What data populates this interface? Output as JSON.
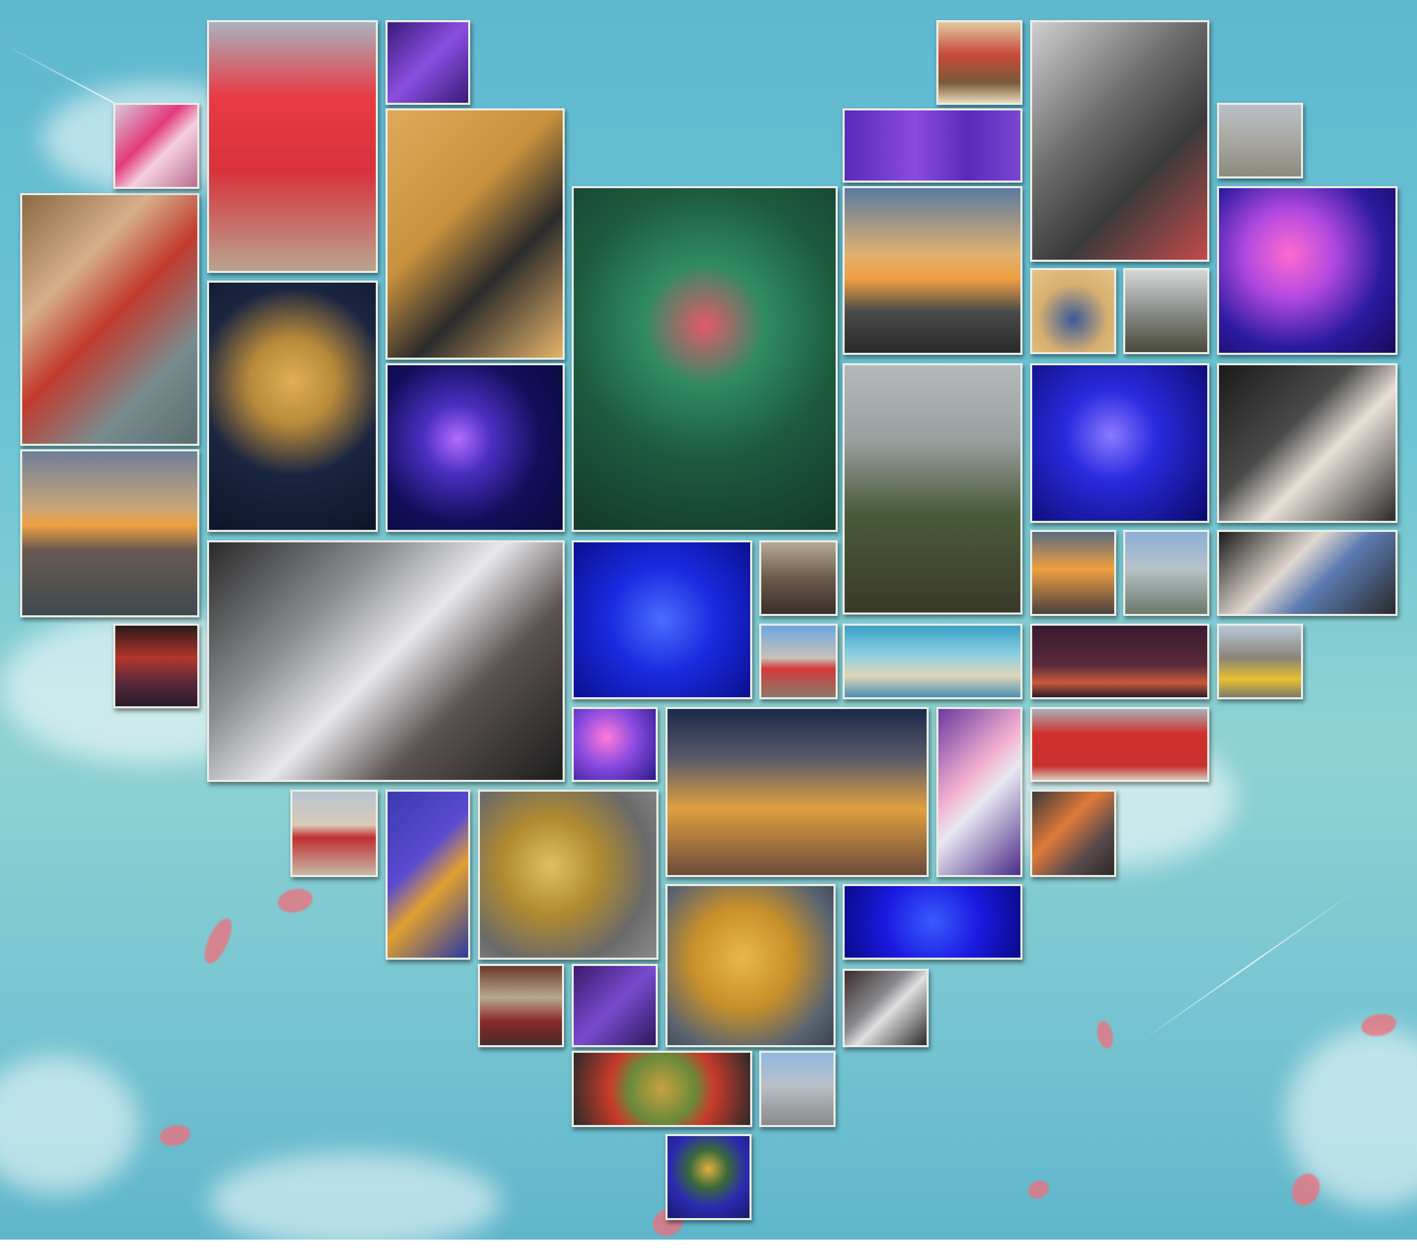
{
  "photos": [
    {
      "id": "p01",
      "name": "photo-man-in-mouth-painting",
      "bg": "linear-gradient(135deg,#8a6a44,#d6b08a 30%,#c23a2e 50%,#7a8b8e 75%,#5a6d6f)"
    },
    {
      "id": "p02",
      "name": "photo-sunset-city-left",
      "bg": "linear-gradient(180deg,#6f7f98,#c9a678 35%,#f0a040 45%,#6a5a52 60%,#3f4a4f)"
    },
    {
      "id": "p03",
      "name": "photo-small-pink-tower",
      "bg": "linear-gradient(135deg,#d7c8d8,#e23a7b 40%,#f4d0df 60%,#b86b8e)"
    },
    {
      "id": "p04",
      "name": "photo-red-arch-gate",
      "bg": "linear-gradient(180deg,#a8b3bd,#e83a44 30%,#d8323c 60%,#b9a48f)"
    },
    {
      "id": "p05",
      "name": "photo-purple-lights-small",
      "bg": "linear-gradient(135deg,#3a1a7a,#8a4fe0 50%,#3a1a7a)"
    },
    {
      "id": "p06",
      "name": "photo-devil-horns-afro",
      "bg": "linear-gradient(135deg,#e0a95a,#c8913e 40%,#2b2b2b 65%,#e5b36a)"
    },
    {
      "id": "p07",
      "name": "photo-angel-wings-painting",
      "bg": "radial-gradient(circle at 50% 40%,#e0b055 0,#b98a3a 25%,#1a2540 55%,#0d1528 100%)"
    },
    {
      "id": "p08",
      "name": "photo-jellyfish-violet",
      "bg": "radial-gradient(circle at 40% 45%,#b36dff 0,#4a2ec0 25%,#120e5a 60%,#0a0a3a)"
    },
    {
      "id": "p09",
      "name": "photo-red-corridor",
      "bg": "linear-gradient(180deg,#2a1a1a,#b3362c 40%,#5a2a3a 70%,#2a1a2a)"
    },
    {
      "id": "p10",
      "name": "photo-couple-3d-glasses",
      "bg": "linear-gradient(135deg,#2a2a2a,#8a8c90 30%,#e8e8ec 50%,#5a5250 70%,#1e1e1e)"
    },
    {
      "id": "p11",
      "name": "photo-throne-green-room",
      "bg": "radial-gradient(circle at 50% 40%,#e25a6a 0,#2f8b62 25%,#1d5a40 55%,#143828)"
    },
    {
      "id": "p12",
      "name": "photo-jellyfish-blue-tank",
      "bg": "radial-gradient(circle at 50% 50%,#4a6dff 0,#1a2ae0 45%,#0a1090)"
    },
    {
      "id": "p13",
      "name": "photo-woman-in-alley",
      "bg": "linear-gradient(180deg,#b9a995,#6a5a4a 50%,#3a2f2a)"
    },
    {
      "id": "p14",
      "name": "photo-red-gate-distance",
      "bg": "linear-gradient(180deg,#6da5e0,#c8c2b8 45%,#d23a3a 60%,#8a7a6a)"
    },
    {
      "id": "p15",
      "name": "photo-balloon-basket-mural",
      "bg": "linear-gradient(180deg,#e0c9a0,#c94a3a 40%,#7a5a3a 75%,#e8d9bb)"
    },
    {
      "id": "p16",
      "name": "photo-purple-lights-wide",
      "bg": "linear-gradient(90deg,#5a2ab8,#8a4be0 40%,#5a2ab8 70%,#7a46d4)"
    },
    {
      "id": "p17",
      "name": "photo-sunset-clouds-city",
      "bg": "linear-gradient(180deg,#5a7aa0,#e0b070 40%,#f0a040 55%,#4a4a4a 75%,#2a2a2a)"
    },
    {
      "id": "p18",
      "name": "photo-rock-diorama",
      "bg": "linear-gradient(180deg,#b4b8b8,#9aa0a0 30%,#4a5a3a 60%,#3a3a2a)"
    },
    {
      "id": "p19",
      "name": "photo-steam-train-mural",
      "bg": "linear-gradient(135deg,#cfcfcf,#6a6a6a 40%,#3a3a3a 65%,#c34a4a)"
    },
    {
      "id": "p20",
      "name": "photo-butterfly-art",
      "bg": "radial-gradient(circle at 50% 60%,#3a5a9a 0,#d8b070 55%,#e3c288)"
    },
    {
      "id": "p21",
      "name": "photo-rocky-cliff",
      "bg": "linear-gradient(180deg,#d6d8d8,#8a8e8a 50%,#4a4a3a)"
    },
    {
      "id": "p22",
      "name": "photo-jellyfish-blue-small",
      "bg": "radial-gradient(circle at 45% 45%,#8a7aff 0,#2a2ae0 35%,#0a0a6a)"
    },
    {
      "id": "p23",
      "name": "photo-sunset-skyline-small",
      "bg": "linear-gradient(180deg,#5a6a80,#f0a040 45%,#4a4040)"
    },
    {
      "id": "p24",
      "name": "photo-city-river",
      "bg": "linear-gradient(180deg,#8ab0d8,#b8c2c8 45%,#6a7a6a)"
    },
    {
      "id": "p25",
      "name": "photo-interior-mural-room",
      "bg": "linear-gradient(180deg,#3aa0c8,#8ad0e0 40%,#e0d6b8 70%,#4a90b0)"
    },
    {
      "id": "p26",
      "name": "photo-night-city",
      "bg": "linear-gradient(180deg,#3a1a30,#5a2a3a 55%,#c85a3a 80%,#2a1a2a)"
    },
    {
      "id": "p27",
      "name": "photo-rubber-ducks",
      "bg": "linear-gradient(180deg,#b8c8d8,#8a8478 45%,#e8c030 75%,#7a7a6a)"
    },
    {
      "id": "p28",
      "name": "photo-grey-plaza",
      "bg": "linear-gradient(180deg,#b8c0c8,#a8a8a0 50%,#8a8a80)"
    },
    {
      "id": "p29",
      "name": "photo-pink-jellyfish",
      "bg": "radial-gradient(circle at 40% 40%,#ff6ad0 0,#b34ae0 30%,#2a1aa0 65%,#1a0a5a)"
    },
    {
      "id": "p30",
      "name": "photo-hands-card-1",
      "bg": "linear-gradient(135deg,#1a1a1a,#4a4a4a 40%,#e8e0d8 60%,#2a2a2a)"
    },
    {
      "id": "p31",
      "name": "photo-hands-card-2",
      "bg": "linear-gradient(135deg,#1a1a1a,#e0d8d0 40%,#5a7ab0 60%,#2a2a2a)"
    },
    {
      "id": "p32",
      "name": "photo-jellyfish-pink-small",
      "bg": "radial-gradient(circle at 40% 40%,#ff7ad8 0,#8a4ae0 45%,#2a1a8a)"
    },
    {
      "id": "p33",
      "name": "photo-dinner-fish-dish",
      "bg": "linear-gradient(180deg,#1a2a4a,#5a5a6a 30%,#e0a040 60%,#6a4a3a)"
    },
    {
      "id": "p34",
      "name": "photo-candy-pillar",
      "bg": "linear-gradient(135deg,#6a3aa0,#f4b0d0 40%,#e8e8f0 55%,#4a2a8a)"
    },
    {
      "id": "p35",
      "name": "photo-red-round-door",
      "bg": "linear-gradient(180deg,#a8b0b8,#d0302c 35%,#c83030 80%,#d8c8b8)"
    },
    {
      "id": "p36",
      "name": "photo-sunset-building",
      "bg": "linear-gradient(135deg,#3a3a3a,#e07a3a 40%,#5a4a4a 70%,#2a2a2a)"
    },
    {
      "id": "p37",
      "name": "photo-red-target-wall",
      "bg": "linear-gradient(180deg,#b8c4d0,#d8cab8 40%,#c03030 55%,#c8b8a8)"
    },
    {
      "id": "p38",
      "name": "photo-little-prince-man",
      "bg": "linear-gradient(135deg,#3a3ab0,#5a4ad0 40%,#e0a030 60%,#2a3aa0)"
    },
    {
      "id": "p39",
      "name": "photo-golden-dragon",
      "bg": "radial-gradient(circle at 40% 45%,#e0c060 0,#b08a30 35%,#6a6a6a 70%,#8a8a8a)"
    },
    {
      "id": "p40",
      "name": "photo-handprint-star",
      "bg": "radial-gradient(circle at 45% 45%,#e8b84a 0,#c8902a 40%,#5a6470 75%,#3a4450)"
    },
    {
      "id": "p41",
      "name": "photo-jellyfish-blue-wide",
      "bg": "radial-gradient(circle at 50% 50%,#3a5aff 0,#1a1ae0 50%,#0a0a8a)"
    },
    {
      "id": "p42",
      "name": "photo-library-desk",
      "bg": "linear-gradient(180deg,#6a3a2a,#b8a890 40%,#8a2a2a 70%,#4a2a2a)"
    },
    {
      "id": "p43",
      "name": "photo-woman-purple-lights",
      "bg": "linear-gradient(135deg,#3a1a6a,#7a4ad0 50%,#2a1a5a)"
    },
    {
      "id": "p44",
      "name": "photo-motorcycle",
      "bg": "linear-gradient(135deg,#3a2a2a,#8a8a90 40%,#e0e0e0 55%,#2a2a2a)"
    },
    {
      "id": "p45",
      "name": "photo-stir-fry-dish",
      "bg": "radial-gradient(circle at 50% 50%,#c8a040 0,#6a8a3a 35%,#c83a2a 55%,#2a2a2a)"
    },
    {
      "id": "p46",
      "name": "photo-steps-monument",
      "bg": "linear-gradient(180deg,#90b8e0,#b8c0c8 45%,#8a8a8a)"
    },
    {
      "id": "p47",
      "name": "photo-little-prince-painting",
      "bg": "radial-gradient(circle at 50% 40%,#e0b040 0,#3a6a3a 30%,#2a2ab0 60%,#1a1a6a)"
    }
  ]
}
